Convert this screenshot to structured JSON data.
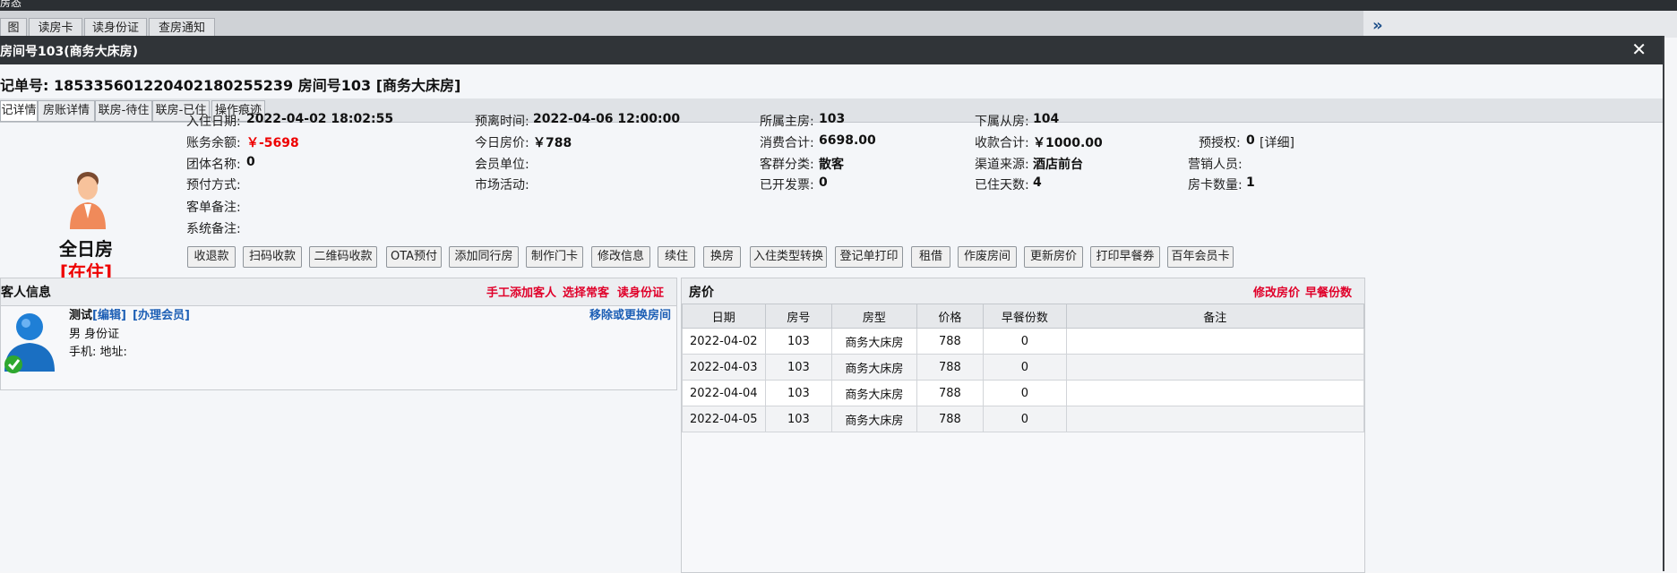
{
  "top": {
    "title": "房态",
    "tabs": [
      "图",
      "读房卡",
      "读身份证",
      "查房通知"
    ],
    "expand_icon": "»"
  },
  "window": {
    "title": "房间号103(商务大床房)",
    "close": "✕",
    "order_line": "记单号: 18533560122040218025523​9 房间号103 [商务大床房]",
    "tabs": [
      "记详情",
      "房账详情",
      "联房-待住",
      "联房-已住",
      "操作痕迹"
    ]
  },
  "room": {
    "type": "全日房",
    "status": "[在住]"
  },
  "info": {
    "checkin_label": "入住日期:",
    "checkin": "2022-04-02 18:02:55",
    "leave_label": "预离时间:",
    "leave": "2022-04-06 12:00:00",
    "master_label": "所属主房:",
    "master": "103",
    "sub_label": "下属从房:",
    "sub": "104",
    "balance_label": "账务余额:",
    "balance": "￥-5698",
    "today_price_label": "今日房价:",
    "today_price": "￥788",
    "consume_label": "消费合计:",
    "consume": "6698.00",
    "receipt_label": "收款合计:",
    "receipt": "￥1000.00",
    "preauth_label": "预授权:",
    "preauth": "0",
    "preauth_detail": "[详细]",
    "group_label": "团体名称:",
    "group": "0",
    "member_unit_label": "会员单位:",
    "guest_class_label": "客群分类:",
    "guest_class": "散客",
    "channel_label": "渠道来源:",
    "channel": "酒店前台",
    "sales_label": "营销人员:",
    "prepay_label": "预付方式:",
    "market_label": "市场活动:",
    "invoice_label": "已开发票:",
    "invoice": "0",
    "days_label": "已住天数:",
    "days": "4",
    "cards_label": "房卡数量:",
    "cards": "1",
    "order_note_label": "客单备注:",
    "sys_note_label": "系统备注:"
  },
  "buttons": [
    "收退款",
    "扫码收款",
    "二维码收款",
    "OTA预付",
    "添加同行房",
    "制作门卡",
    "修改信息",
    "续住",
    "换房",
    "入住类型转换",
    "登记单打印",
    "租借",
    "作废房间",
    "更新房价",
    "打印早餐券",
    "百年会员卡"
  ],
  "guest_panel": {
    "title": "客人信息",
    "links": [
      "手工添加客人",
      "选择常客",
      "读身份证"
    ],
    "name": "测试",
    "edit": "[编辑]",
    "member": "[办理会员]",
    "move": "移除或更换房间",
    "gender_id": "男 身份证",
    "phone_addr": "手机:   地址:"
  },
  "price_panel": {
    "title": "房价",
    "links": [
      "修改房价",
      "早餐份数"
    ],
    "columns": [
      "日期",
      "房号",
      "房型",
      "价格",
      "早餐份数",
      "备注"
    ],
    "rows": [
      [
        "2022-04-02",
        "103",
        "商务大床房",
        "788",
        "0",
        ""
      ],
      [
        "2022-04-03",
        "103",
        "商务大床房",
        "788",
        "0",
        ""
      ],
      [
        "2022-04-04",
        "103",
        "商务大床房",
        "788",
        "0",
        ""
      ],
      [
        "2022-04-05",
        "103",
        "商务大床房",
        "788",
        "0",
        ""
      ]
    ]
  },
  "colors": {
    "accent_red": "#e00000",
    "link_blue": "#1d5fb5",
    "titlebar": "#303438"
  }
}
